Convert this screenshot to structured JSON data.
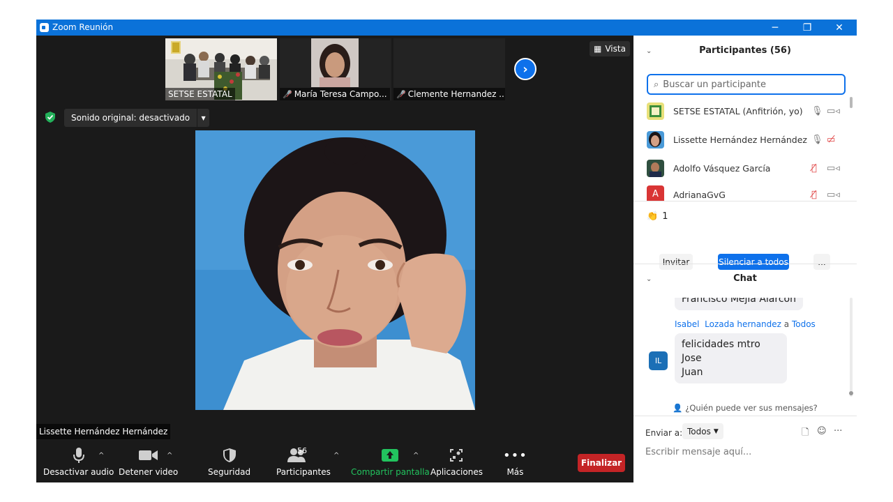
{
  "window": {
    "title": "Zoom Reunión",
    "minimize": "─",
    "restore": "❐",
    "close": "✕"
  },
  "gallery": {
    "thumbs": [
      {
        "name": "SETSE ESTATAL"
      },
      {
        "name": "María Teresa Campo..."
      },
      {
        "name": "Clemente Hernandez ..."
      }
    ],
    "view_label": "Vista"
  },
  "audio": {
    "original_sound": "Sonido original: desactivado"
  },
  "speaker": {
    "name": "Lissette Hernández Hernández"
  },
  "toolbar": {
    "audio": "Desactivar audio",
    "video": "Detener video",
    "security": "Seguridad",
    "participants": "Participantes",
    "participants_count": "56",
    "share": "Compartir pantalla",
    "apps": "Aplicaciones",
    "more": "Más",
    "end": "Finalizar"
  },
  "participants_panel": {
    "title": "Participantes (56)",
    "search_placeholder": "Buscar un participante",
    "list": [
      {
        "name": "SETSE ESTATAL (Anfitrión, yo)",
        "avatar_letter": ""
      },
      {
        "name": "Lissette Hernández Hernández",
        "avatar_letter": ""
      },
      {
        "name": "Adolfo Vásquez García",
        "avatar_letter": ""
      },
      {
        "name": "AdrianaGvG",
        "avatar_letter": "A"
      }
    ],
    "raised_hands": "1",
    "invite": "Invitar",
    "mute_all": "Silenciar a todos",
    "more": "..."
  },
  "chat": {
    "title": "Chat",
    "prev_message": "Francisco Mejía Alarcón",
    "sender_first": "Isabel",
    "sender_rest": "Lozada hernandez",
    "to_word": "a",
    "recipient": "Todos",
    "sender_initials": "IL",
    "message_line1": "felicidades mtro Jose",
    "message_line2": "Juan",
    "who_can_see": "¿Quién puede ver sus mensajes?",
    "send_to_label": "Enviar a:",
    "send_to_value": "Todos",
    "input_placeholder": "Escribir mensaje aquí..."
  },
  "colors": {
    "title_bar": "#0b72d9",
    "accent": "#0e71eb",
    "end_button": "#c42426",
    "share_green": "#22c35e",
    "mic_off_red": "#e04343"
  }
}
